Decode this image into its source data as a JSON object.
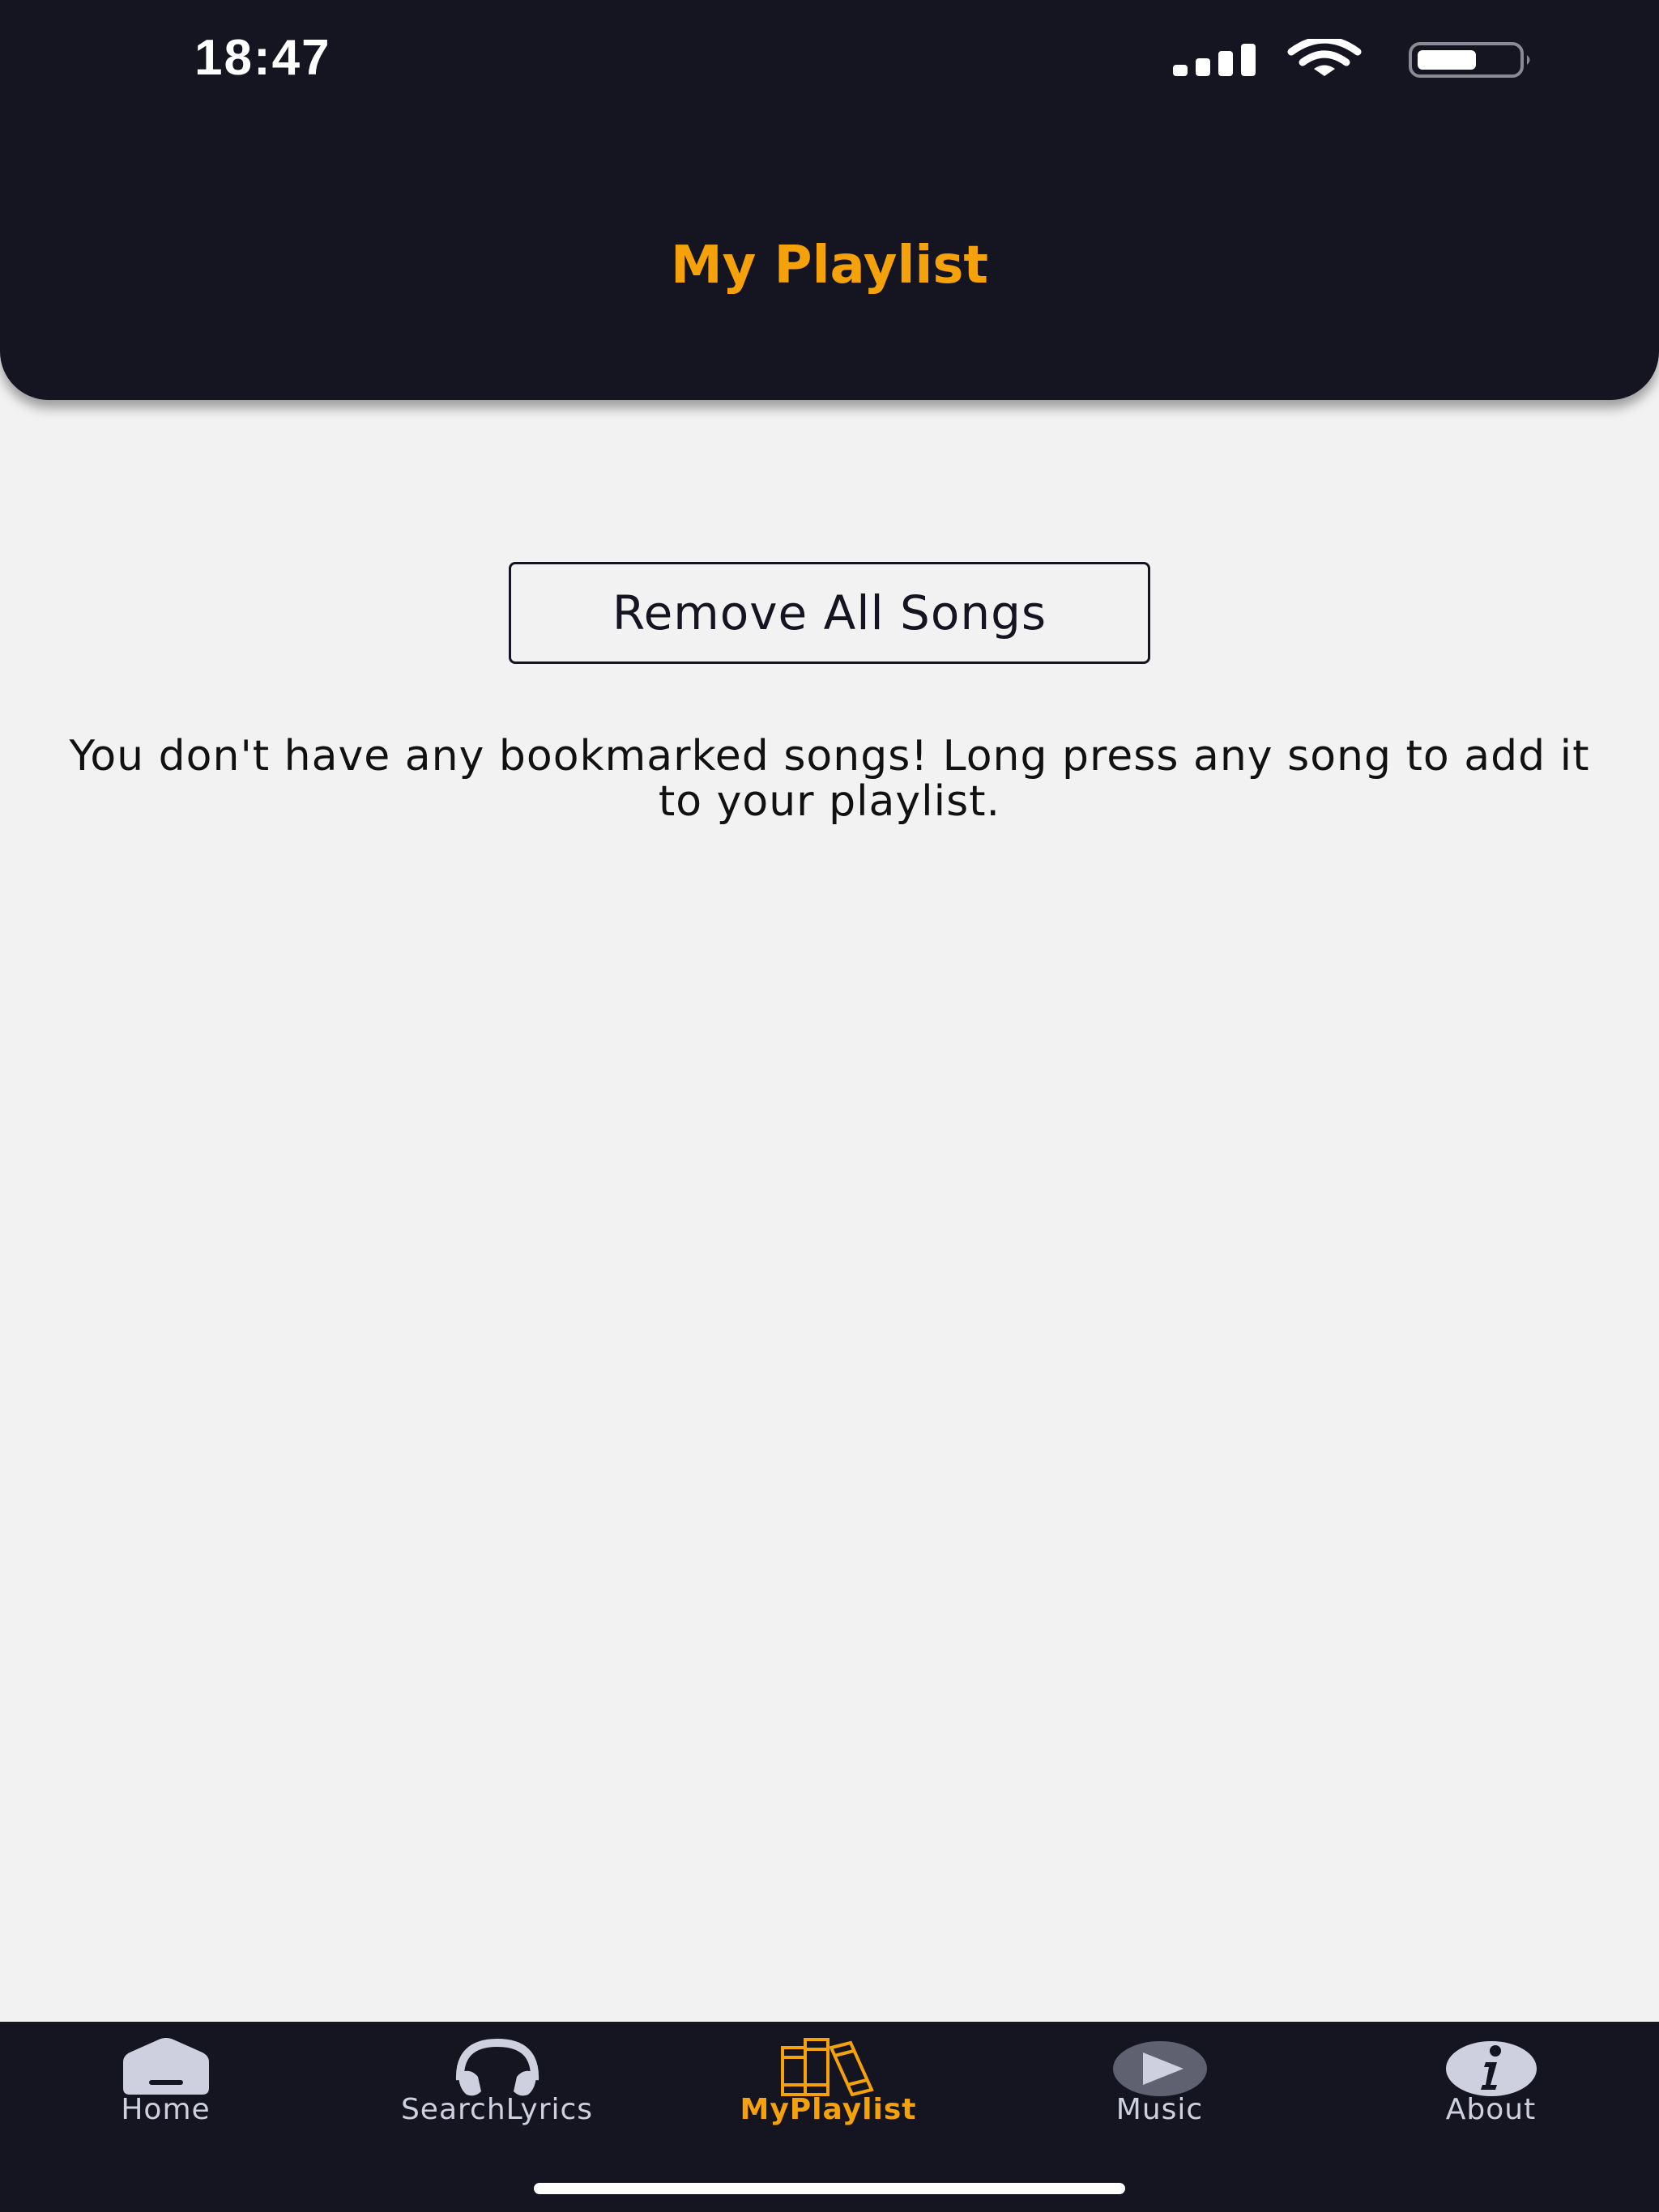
{
  "status_bar": {
    "time": "18:47",
    "icons": [
      "signal-icon",
      "wifi-icon",
      "battery-icon"
    ]
  },
  "header": {
    "title": "My Playlist"
  },
  "main": {
    "remove_all_label": "Remove All Songs",
    "empty_message": "You don't have any bookmarked songs! Long press any song to add it to your playlist."
  },
  "tab_bar": {
    "tabs": [
      {
        "label": "Home",
        "icon": "home-icon",
        "active": false
      },
      {
        "label": "SearchLyrics",
        "icon": "headphones-icon",
        "active": false
      },
      {
        "label": "MyPlaylist",
        "icon": "library-icon",
        "active": true
      },
      {
        "label": "Music",
        "icon": "play-icon",
        "active": false
      },
      {
        "label": "About",
        "icon": "info-icon",
        "active": false
      }
    ]
  },
  "colors": {
    "header_bg": "#151522",
    "accent": "#f5a20a",
    "background": "#f2f2f2",
    "tab_inactive": "#cfd0df"
  }
}
